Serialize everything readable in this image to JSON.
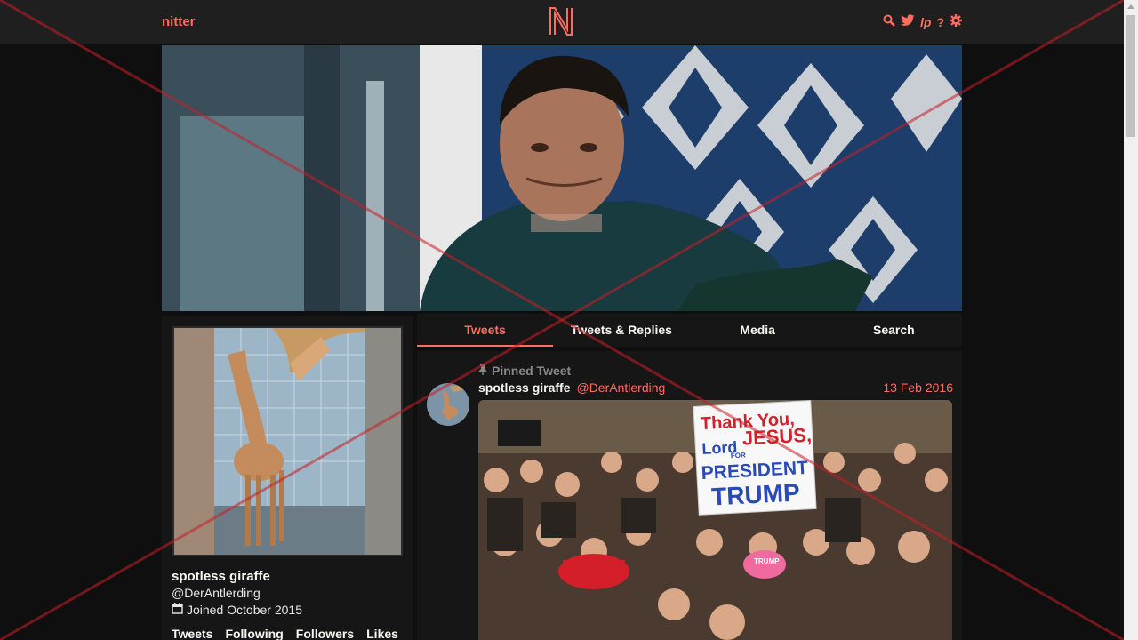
{
  "nav": {
    "brand": "nitter",
    "logo_letter": "N",
    "icons": [
      "search-icon",
      "twitter-icon",
      "lp-icon",
      "help-icon",
      "gear-icon"
    ],
    "lp_text": "lp",
    "help_text": "?"
  },
  "profile": {
    "name": "spotless giraffe",
    "handle": "@DerAntlerding",
    "joined": "Joined October 2015",
    "stats": [
      "Tweets",
      "Following",
      "Followers",
      "Likes"
    ]
  },
  "tabs": [
    {
      "label": "Tweets",
      "active": true
    },
    {
      "label": "Tweets & Replies",
      "active": false
    },
    {
      "label": "Media",
      "active": false
    },
    {
      "label": "Search",
      "active": false
    }
  ],
  "tweet": {
    "pinned_label": "Pinned Tweet",
    "name": "spotless giraffe",
    "handle": "@DerAntlerding",
    "date": "13 Feb 2016",
    "sign_line1": "Thank You,",
    "sign_line2": "Lord",
    "sign_line3": "JESUS,",
    "sign_line4": "FOR",
    "sign_line5": "PRESIDENT",
    "sign_line6": "TRUMP",
    "hat_text": "TRUMP"
  },
  "colors": {
    "accent": "#ff6c60",
    "background": "#0f0f0f",
    "panel": "#161616",
    "navbar": "#1f1f1f"
  }
}
